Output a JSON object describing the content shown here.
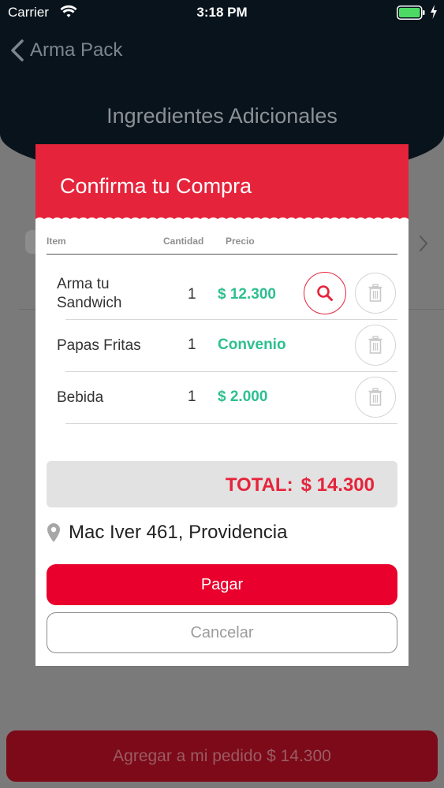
{
  "status_bar": {
    "carrier": "Carrier",
    "time": "3:18 PM"
  },
  "nav": {
    "back_label": "Arma Pack"
  },
  "section": {
    "title": "Ingredientes Adicionales"
  },
  "modal": {
    "title": "Confirma tu Compra",
    "columns": {
      "item": "Item",
      "quantity": "Cantidad",
      "price": "Precio"
    },
    "rows": [
      {
        "item_line1": "Arma tu",
        "item_line2": "Sandwich",
        "quantity": "1",
        "price": "$ 12.300"
      },
      {
        "item": "Papas Fritas",
        "quantity": "1",
        "price": "Convenio"
      },
      {
        "item": "Bebida",
        "quantity": "1",
        "price": "$ 2.000"
      }
    ],
    "total_label": "TOTAL:",
    "total_value": "$ 14.300",
    "address": "Mac Iver 461, Providencia",
    "pay_label": "Pagar",
    "cancel_label": "Cancelar"
  },
  "bottom_button": {
    "label": "Agregar a mi pedido $ 14.300"
  },
  "colors": {
    "accent_red": "#e5243b",
    "price_green": "#2dbf90",
    "header_dark": "#09131b",
    "battery_green": "#4cd964"
  },
  "icons": [
    "wifi-icon",
    "battery-icon",
    "back-chevron-icon",
    "search-icon",
    "trash-icon",
    "location-pin-icon",
    "chevron-right-icon"
  ]
}
